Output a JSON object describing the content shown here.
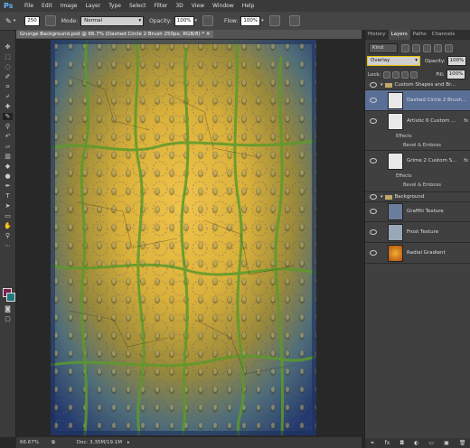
{
  "app_logo": "Ps",
  "menu": [
    "File",
    "Edit",
    "Image",
    "Layer",
    "Type",
    "Select",
    "Filter",
    "3D",
    "View",
    "Window",
    "Help"
  ],
  "options": {
    "brush_size": "250",
    "mode_label": "Mode:",
    "mode_value": "Normal",
    "opacity_label": "Opacity:",
    "opacity_value": "100%",
    "flow_label": "Flow:",
    "flow_value": "100%"
  },
  "document": {
    "tab_title": "Grunge Background.psd @ 66.7% (Dashed Circle 2 Brush 250px, RGB/8) *",
    "zoom": "66.67%",
    "doc_size": "Doc: 3.35M/19.1M"
  },
  "panel_tabs": [
    "History",
    "Layers",
    "Paths",
    "Channels"
  ],
  "layers_panel": {
    "kind_label": "Kind",
    "blend_mode": "Overlay",
    "opacity_label": "Opacity:",
    "opacity_value": "100%",
    "lock_label": "Lock:",
    "fill_label": "Fill:",
    "fill_value": "100%",
    "layers": [
      {
        "name": "Custom Shapes and Br...",
        "type": "group"
      },
      {
        "name": "Dashed Circle 2 Brush...",
        "type": "layer",
        "selected": true
      },
      {
        "name": "Artistic 6 Custom ...",
        "type": "layer"
      },
      {
        "name": "Effects",
        "type": "effects"
      },
      {
        "name": "Bevel & Emboss",
        "type": "effect"
      },
      {
        "name": "Grime 2 Custom S...",
        "type": "layer"
      },
      {
        "name": "Effects",
        "type": "effects"
      },
      {
        "name": "Bevel & Emboss",
        "type": "effect"
      },
      {
        "name": "Background",
        "type": "group"
      },
      {
        "name": "Graffiti Texture",
        "type": "layer"
      },
      {
        "name": "Frost Texture",
        "type": "layer"
      },
      {
        "name": "Radial Gradient",
        "type": "layer"
      }
    ]
  },
  "colors": {
    "foreground": "#7a1f4f",
    "background": "#1f7a7e",
    "selection": "#5a6f96"
  }
}
